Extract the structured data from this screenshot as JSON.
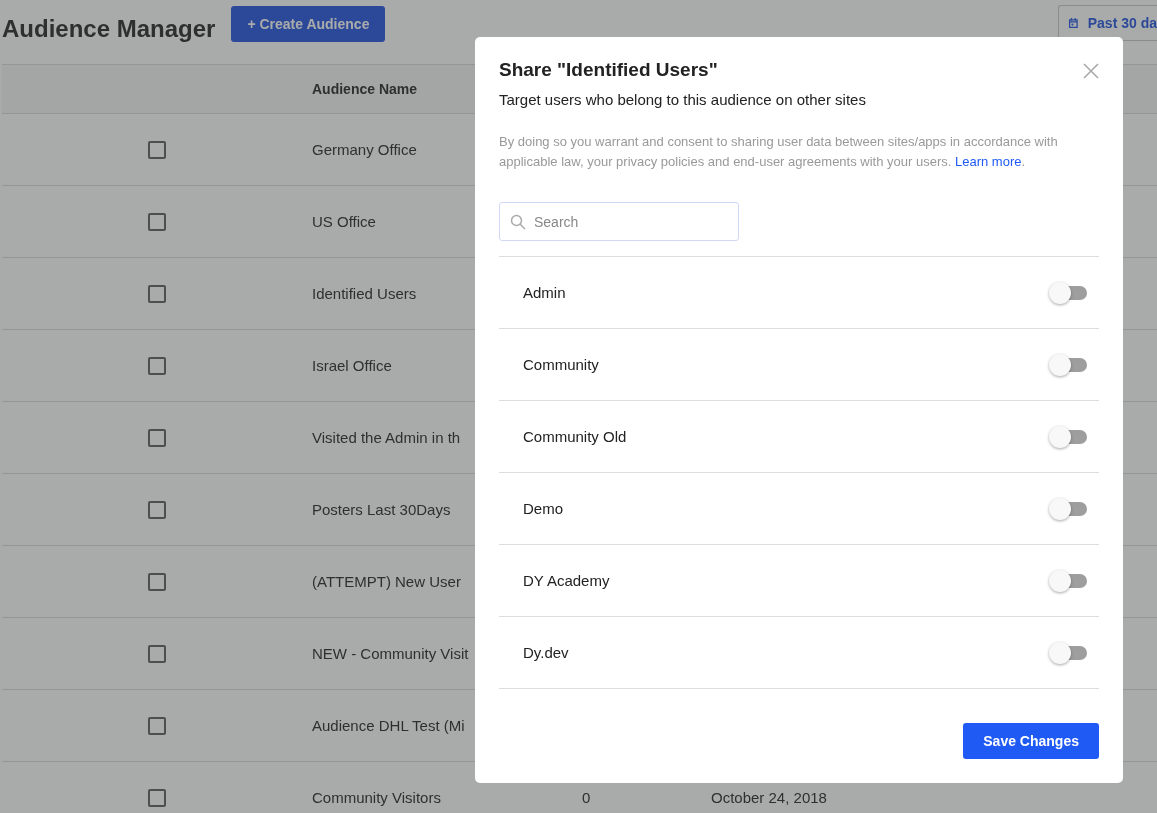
{
  "page": {
    "title": "Audience Manager",
    "create_button": "+ Create Audience",
    "date_range": "Past 30 da"
  },
  "table": {
    "columns": [
      "Audience Name"
    ],
    "rows": [
      {
        "name": "Germany Office",
        "checked": false
      },
      {
        "name": "US Office",
        "checked": false
      },
      {
        "name": "Identified Users",
        "checked": false
      },
      {
        "name": "Israel Office",
        "checked": false
      },
      {
        "name": "Visited the Admin in th",
        "checked": false
      },
      {
        "name": "Posters Last 30Days",
        "checked": false
      },
      {
        "name": "(ATTEMPT) New User",
        "checked": false
      },
      {
        "name": "NEW - Community Visit",
        "checked": false
      },
      {
        "name": "Audience DHL Test (Mi",
        "checked": false
      },
      {
        "name": "Community Visitors",
        "checked": false,
        "count": "0",
        "date": "October 24, 2018"
      }
    ]
  },
  "dialog": {
    "title": "Share \"Identified Users\"",
    "subtitle": "Target users who belong to this audience on other sites",
    "notice": "By doing so you warrant and consent to sharing user data between sites/apps in accordance with applicable law, your privacy policies and end-user agreements with your users.",
    "notice_link": "Learn more",
    "notice_end": ".",
    "search": {
      "placeholder": "Search"
    },
    "sites": [
      {
        "name": "Admin",
        "on": false
      },
      {
        "name": "Community",
        "on": false
      },
      {
        "name": "Community Old",
        "on": false
      },
      {
        "name": "Demo",
        "on": false
      },
      {
        "name": "DY Academy",
        "on": false
      },
      {
        "name": "Dy.dev",
        "on": false
      }
    ],
    "save_button": "Save Changes"
  }
}
